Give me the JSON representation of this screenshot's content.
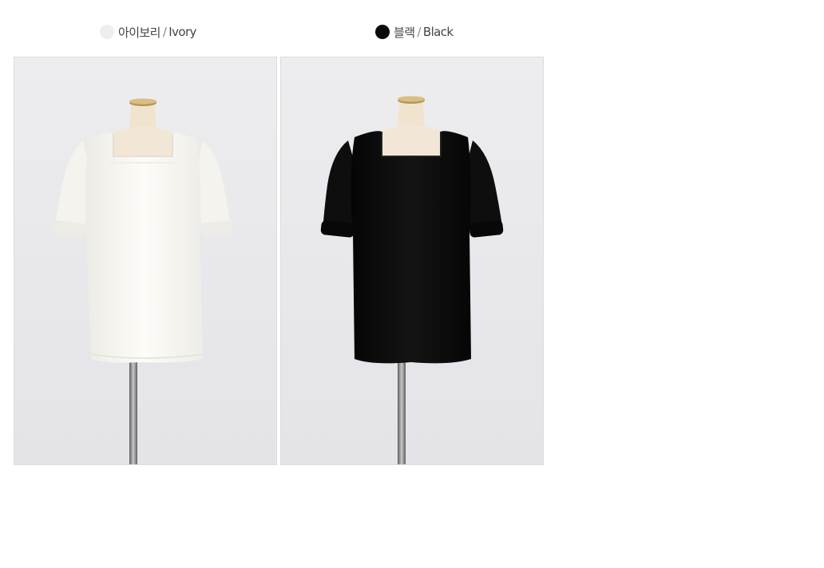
{
  "colors": [
    {
      "name_ko": "아이보리",
      "separator": "/",
      "name_en": "Ivory",
      "swatch": "#eeeeee",
      "garment": "#fbfaf6"
    },
    {
      "name_ko": "블랙",
      "separator": "/",
      "name_en": "Black",
      "swatch": "#0a0a0a",
      "garment": "#0c0c0c"
    }
  ],
  "palette": {
    "backdrop": "#ececef",
    "mannequin": "#f2e7d6",
    "stand": "#8a8a8a"
  }
}
